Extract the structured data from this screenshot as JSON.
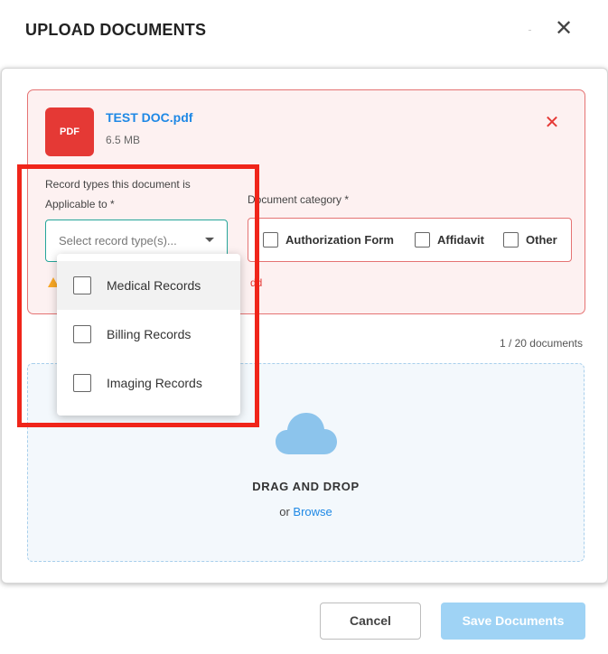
{
  "dialog": {
    "title": "UPLOAD DOCUMENTS",
    "close_icon": "close-icon"
  },
  "file": {
    "badge": "PDF",
    "name": "TEST DOC.pdf",
    "size": "6.5 MB",
    "remove_icon": "remove-icon"
  },
  "record_types": {
    "label_line1": "Record types this document is",
    "label_line2": "Applicable to *",
    "placeholder": "Select record type(s)...",
    "warning_text": "dd",
    "options": [
      "Medical Records",
      "Billing Records",
      "Imaging Records"
    ]
  },
  "document_category": {
    "label": "Document category *",
    "options": [
      "Authorization Form",
      "Affidavit",
      "Other"
    ]
  },
  "counter": "1 / 20 documents",
  "dropzone": {
    "title": "DRAG AND DROP",
    "or_text": "or ",
    "browse_label": "Browse",
    "icon": "cloud-upload-icon"
  },
  "footer": {
    "cancel_label": "Cancel",
    "save_label": "Save Documents"
  },
  "colors": {
    "accent": "#1e88e5",
    "error": "#e53935",
    "highlight": "#f0251a",
    "save_disabled": "#9fd3f5"
  }
}
